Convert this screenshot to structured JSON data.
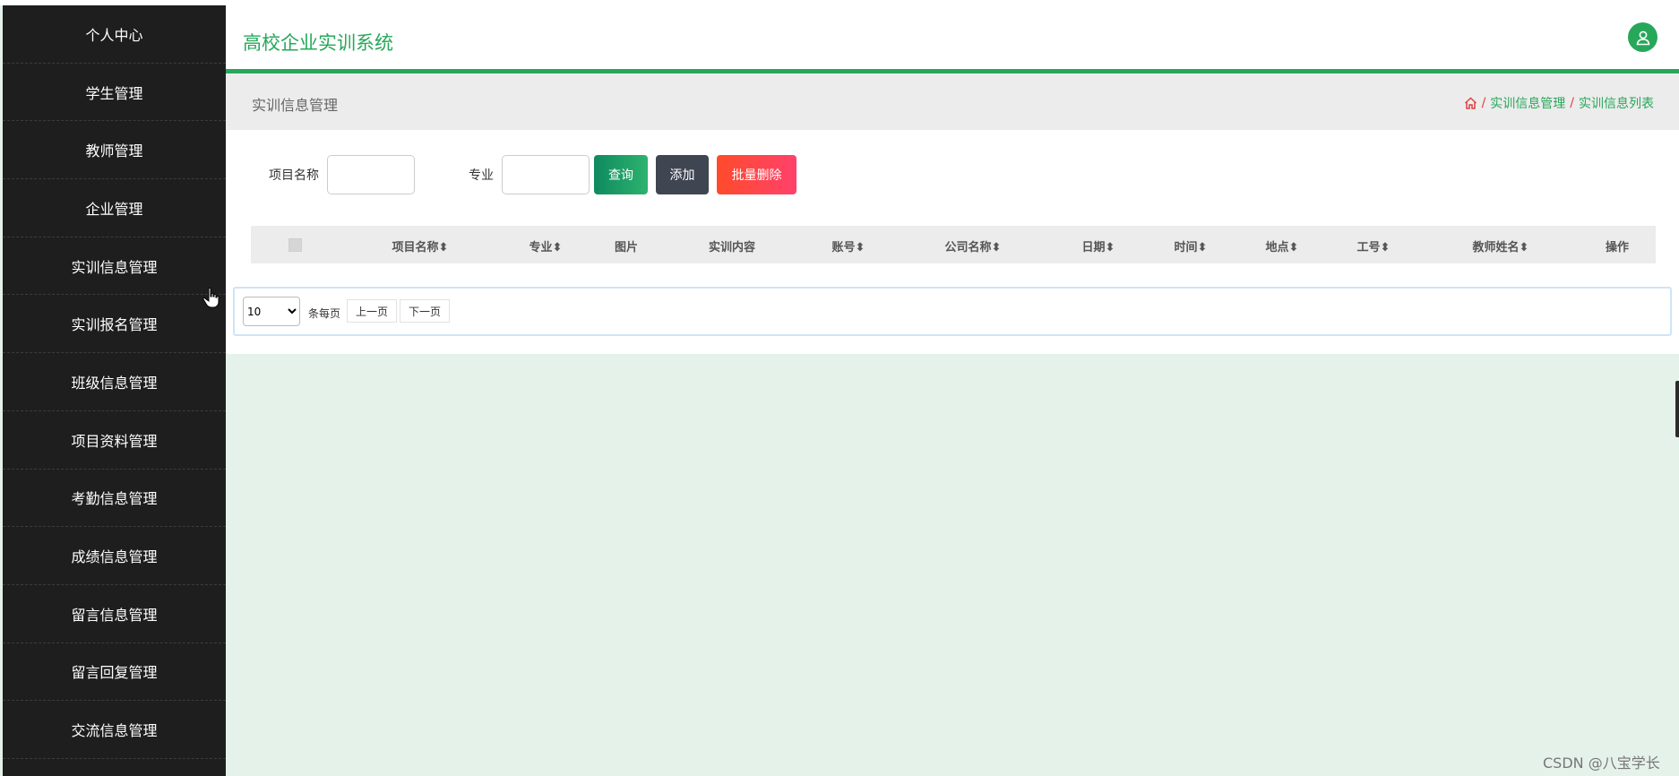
{
  "sidebar": {
    "items": [
      {
        "label": "个人中心"
      },
      {
        "label": "学生管理"
      },
      {
        "label": "教师管理"
      },
      {
        "label": "企业管理"
      },
      {
        "label": "实训信息管理"
      },
      {
        "label": "实训报名管理"
      },
      {
        "label": "班级信息管理"
      },
      {
        "label": "项目资料管理"
      },
      {
        "label": "考勤信息管理"
      },
      {
        "label": "成绩信息管理"
      },
      {
        "label": "留言信息管理"
      },
      {
        "label": "留言回复管理"
      },
      {
        "label": "交流信息管理"
      }
    ]
  },
  "header": {
    "title": "高校企业实训系统",
    "avatar_icon": "user-icon",
    "accent_color": "#27a75a"
  },
  "subbar": {
    "title": "实训信息管理",
    "breadcrumb": [
      "实训信息管理",
      "实训信息列表"
    ],
    "home_icon": "home-icon"
  },
  "search": {
    "field1_label": "项目名称",
    "field1_value": "",
    "field2_label": "专业",
    "field2_value": "",
    "query_label": "查询",
    "add_label": "添加",
    "batch_delete_label": "批量删除"
  },
  "table": {
    "columns": [
      {
        "label": "项目名称",
        "sortable": true
      },
      {
        "label": "专业",
        "sortable": true
      },
      {
        "label": "图片",
        "sortable": false
      },
      {
        "label": "实训内容",
        "sortable": false
      },
      {
        "label": "账号",
        "sortable": true
      },
      {
        "label": "公司名称",
        "sortable": true
      },
      {
        "label": "日期",
        "sortable": true
      },
      {
        "label": "时间",
        "sortable": true
      },
      {
        "label": "地点",
        "sortable": true
      },
      {
        "label": "工号",
        "sortable": true
      },
      {
        "label": "教师姓名",
        "sortable": true
      },
      {
        "label": "操作",
        "sortable": false
      }
    ],
    "rows": []
  },
  "pager": {
    "page_size": "10",
    "page_size_options": [
      "10"
    ],
    "per_page_text": "条每页",
    "prev_label": "上一页",
    "next_label": "下一页"
  },
  "watermark": "CSDN @八宝学长"
}
